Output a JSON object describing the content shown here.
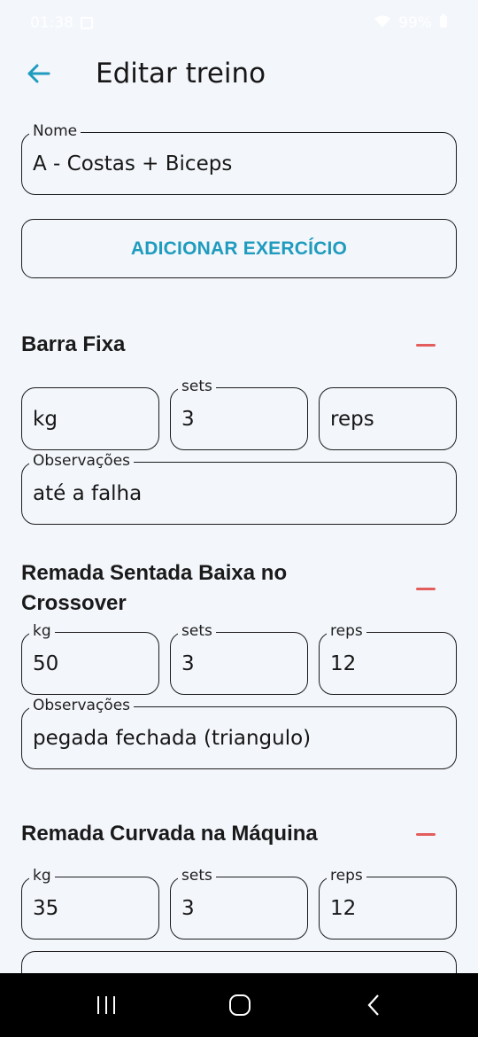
{
  "status_bar": {
    "time": "01:38",
    "battery": "99%"
  },
  "header": {
    "title": "Editar treino",
    "back_icon": "arrow-left-icon"
  },
  "name_field": {
    "label": "Nome",
    "value": "A - Costas + Biceps"
  },
  "add_button": {
    "label": "ADICIONAR EXERCÍCIO"
  },
  "exercises": [
    {
      "name": "Barra Fixa",
      "kg": {
        "label": "",
        "value": "",
        "placeholder": "kg"
      },
      "sets": {
        "label": "sets",
        "value": "3"
      },
      "reps": {
        "label": "",
        "value": "",
        "placeholder": "reps"
      },
      "notes": {
        "label": "Observações",
        "value": "até a falha"
      }
    },
    {
      "name": "Remada Sentada Baixa no Crossover",
      "kg": {
        "label": "kg",
        "value": "50"
      },
      "sets": {
        "label": "sets",
        "value": "3"
      },
      "reps": {
        "label": "reps",
        "value": "12"
      },
      "notes": {
        "label": "Observações",
        "value": "pegada fechada (triangulo)"
      }
    },
    {
      "name": "Remada Curvada na Máquina",
      "kg": {
        "label": "kg",
        "value": "35"
      },
      "sets": {
        "label": "sets",
        "value": "3"
      },
      "reps": {
        "label": "reps",
        "value": "12"
      }
    }
  ],
  "colors": {
    "accent": "#1e9bbe",
    "remove": "#e35d5d",
    "background": "#f3f6fb"
  },
  "nav": {
    "recents_icon": "recents-icon",
    "home_icon": "home-icon",
    "back_icon": "nav-back-icon"
  }
}
